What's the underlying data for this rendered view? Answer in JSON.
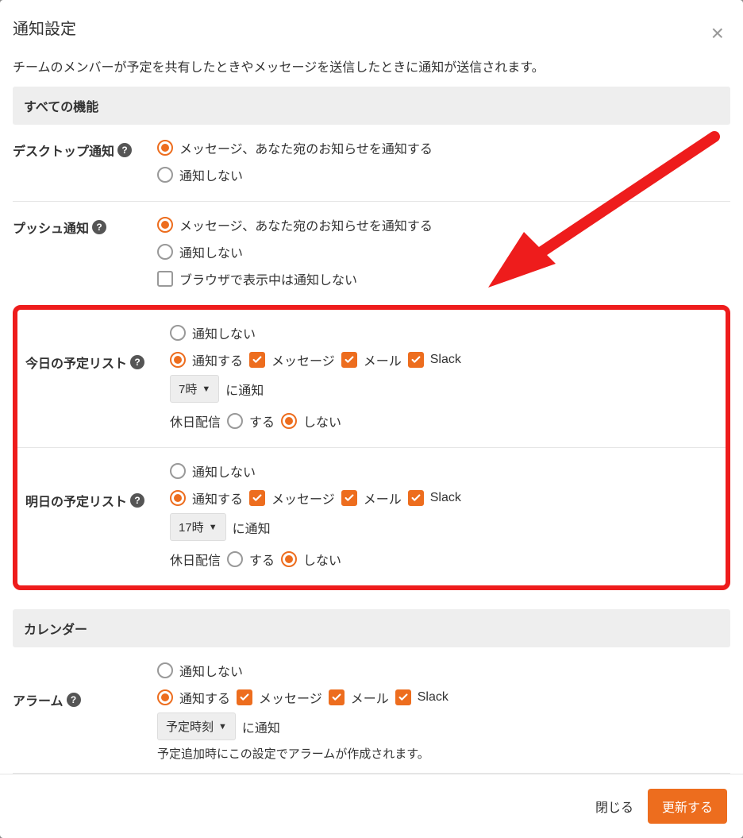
{
  "modal": {
    "title": "通知設定",
    "description": "チームのメンバーが予定を共有したときやメッセージを送信したときに通知が送信されます。"
  },
  "section_all": {
    "header": "すべての機能"
  },
  "desktop": {
    "label": "デスクトップ通知",
    "opt_notify": "メッセージ、あなた宛のお知らせを通知する",
    "opt_none": "通知しない"
  },
  "push": {
    "label": "プッシュ通知",
    "opt_notify": "メッセージ、あなた宛のお知らせを通知する",
    "opt_none": "通知しない",
    "opt_browser": "ブラウザで表示中は通知しない"
  },
  "today": {
    "label": "今日の予定リスト",
    "opt_none": "通知しない",
    "opt_notify": "通知する",
    "chk_message": "メッセージ",
    "chk_mail": "メール",
    "chk_slack": "Slack",
    "time_value": "7時",
    "time_suffix": "に通知",
    "holiday_label": "休日配信",
    "holiday_yes": "する",
    "holiday_no": "しない"
  },
  "tomorrow": {
    "label": "明日の予定リスト",
    "opt_none": "通知しない",
    "opt_notify": "通知する",
    "chk_message": "メッセージ",
    "chk_mail": "メール",
    "chk_slack": "Slack",
    "time_value": "17時",
    "time_suffix": "に通知",
    "holiday_label": "休日配信",
    "holiday_yes": "する",
    "holiday_no": "しない"
  },
  "section_calendar": {
    "header": "カレンダー"
  },
  "alarm": {
    "label": "アラーム",
    "opt_none": "通知しない",
    "opt_notify": "通知する",
    "chk_message": "メッセージ",
    "chk_mail": "メール",
    "chk_slack": "Slack",
    "time_value": "予定時刻",
    "time_suffix": "に通知",
    "note": "予定追加時にこの設定でアラームが作成されます。"
  },
  "footer": {
    "close": "閉じる",
    "update": "更新する"
  }
}
